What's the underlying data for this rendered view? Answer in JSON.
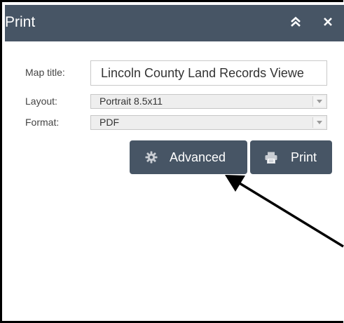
{
  "header": {
    "title": "Print",
    "collapse_icon": "double-chevron-up-icon",
    "close_icon": "close-icon",
    "bg_color": "#475565"
  },
  "form": {
    "map_title_label": "Map title:",
    "map_title_value": "Lincoln County Land Records Viewe",
    "layout_label": "Layout:",
    "layout_value": "Portrait 8.5x11",
    "format_label": "Format:",
    "format_value": "PDF"
  },
  "buttons": {
    "advanced_label": "Advanced",
    "advanced_icon": "gear-icon",
    "print_label": "Print",
    "print_icon": "printer-icon",
    "color": "#475565"
  },
  "annotation": {
    "arrow_icon": "pointer-arrow-icon"
  }
}
